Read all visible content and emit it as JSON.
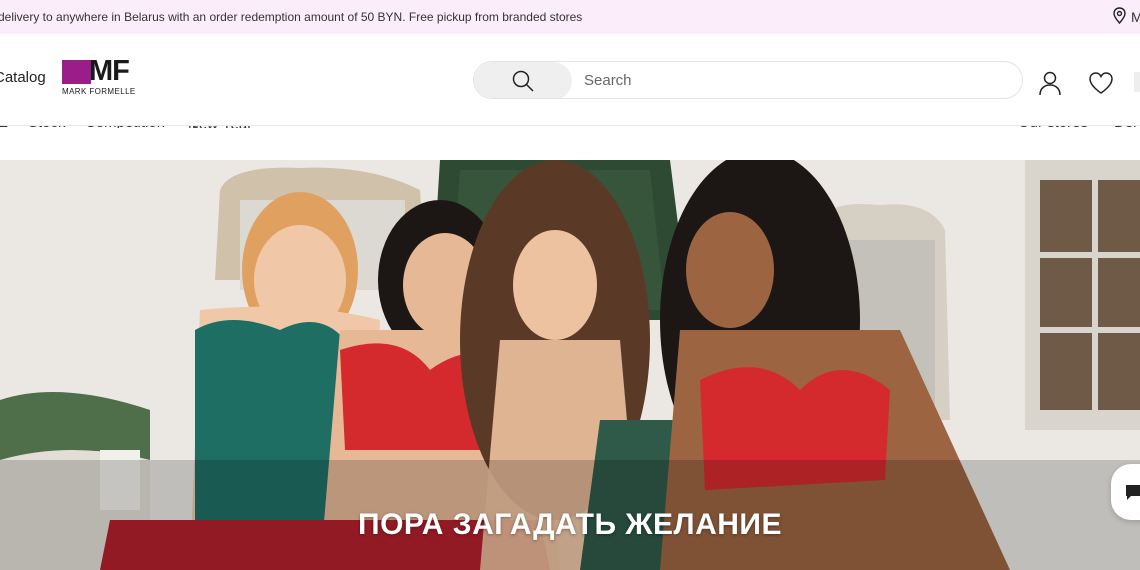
{
  "promo": {
    "text": "delivery to anywhere in Belarus with an order redemption amount of 50 BYN. Free pickup from branded stores",
    "location_label": "M"
  },
  "header": {
    "catalog_label": "Catalog",
    "logo": {
      "letters": "MF",
      "subtitle": "MARK FORMELLE"
    },
    "search_placeholder": "Search"
  },
  "subnav": {
    "left_items": [
      "E",
      "Stock",
      "Competition",
      "New Year"
    ],
    "right_items": [
      "Our stores",
      "Del"
    ]
  },
  "hero": {
    "title": "ПОРА ЗАГАДАТЬ ЖЕЛАНИЕ"
  },
  "colors": {
    "promo_bg": "#fbeefa",
    "brand": "#9b1d8a"
  },
  "icons": [
    "location-pin-icon",
    "search-icon",
    "user-icon",
    "heart-icon",
    "chat-icon",
    "tree-icon"
  ]
}
